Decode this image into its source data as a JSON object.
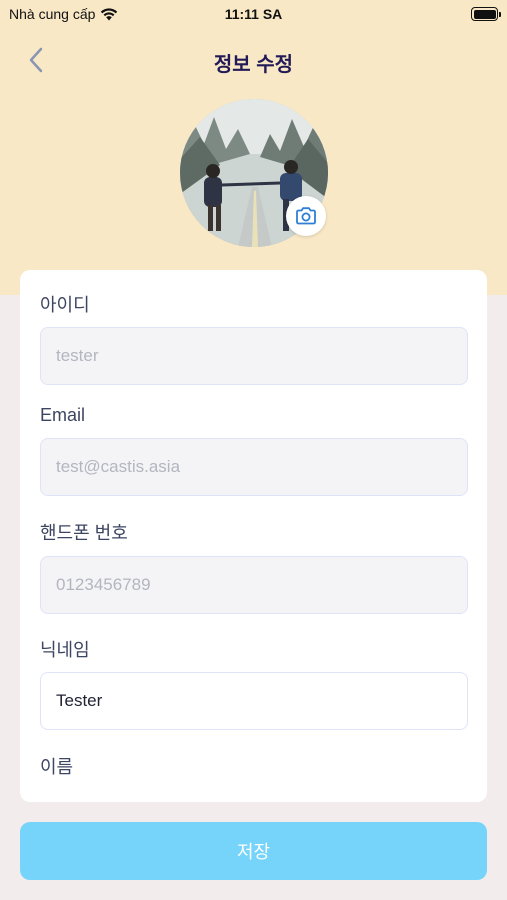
{
  "status_bar": {
    "carrier": "Nhà cung cấp",
    "time": "11:11 SA"
  },
  "nav": {
    "title": "정보 수정",
    "back_icon": "chevron-left-icon"
  },
  "profile": {
    "camera_icon": "camera-icon"
  },
  "form": {
    "id_label": "아이디",
    "id_value": "tester",
    "email_label": "Email",
    "email_value": "test@castis.asia",
    "phone_label": "핸드폰 번호",
    "phone_value": "0123456789",
    "nickname_label": "닉네임",
    "nickname_value": "Tester",
    "name_label": "이름"
  },
  "save_label": "저장",
  "colors": {
    "header_bg": "#f8e8c6",
    "page_bg": "#f2ecec",
    "title": "#221a57",
    "save_button": "#76d4fb",
    "camera_icon": "#2e7fd6"
  }
}
